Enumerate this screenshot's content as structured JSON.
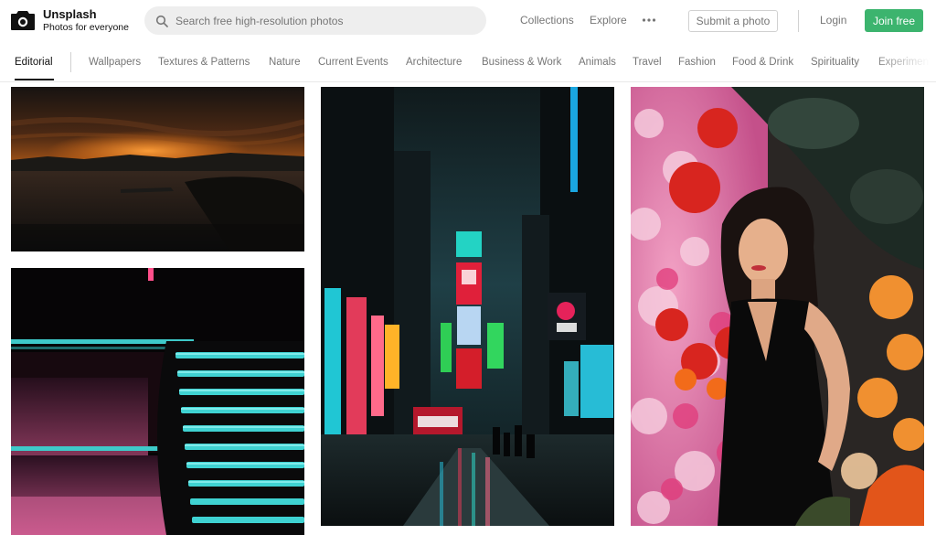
{
  "brand": {
    "name": "Unsplash",
    "tagline": "Photos for everyone"
  },
  "search": {
    "placeholder": "Search free high-resolution photos",
    "value": ""
  },
  "nav": {
    "collections": "Collections",
    "explore": "Explore",
    "more_icon": "more-horizontal-icon",
    "submit": "Submit a photo",
    "login": "Login",
    "join": "Join free"
  },
  "topics": {
    "active": "Editorial",
    "items": [
      "Wallpapers",
      "Textures & Patterns",
      "Nature",
      "Current Events",
      "Architecture",
      "Business & Work",
      "Animals",
      "Travel",
      "Fashion",
      "Food & Drink",
      "Spirituality",
      "Experiments"
    ]
  },
  "colors": {
    "brand_green": "#3cb46e",
    "text_muted": "#767676",
    "search_bg": "#eeeeee",
    "text_primary": "#111111"
  },
  "photos": [
    {
      "subject": "orange sunset over dark sea and island"
    },
    {
      "subject": "neon teal and pink curved building lights"
    },
    {
      "subject": "Times Square at night with neon signs"
    },
    {
      "subject": "woman in black dress among red and pink flowers"
    }
  ]
}
